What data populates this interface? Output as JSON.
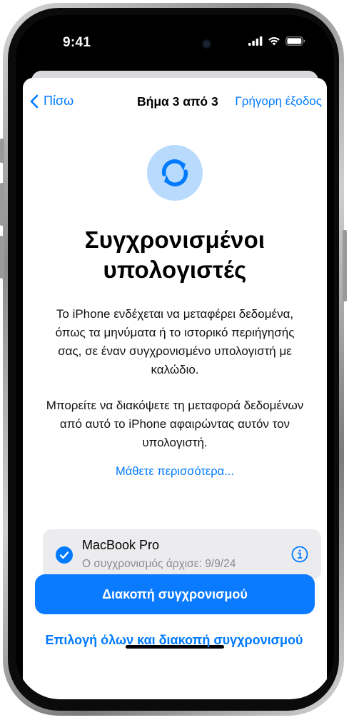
{
  "status_bar": {
    "time": "9:41",
    "icons": [
      "cellular-signal-icon",
      "wifi-icon",
      "battery-icon"
    ]
  },
  "nav": {
    "back_label": "Πίσω",
    "step_label": "Βήμα 3 από 3",
    "exit_label": "Γρήγορη έξοδος"
  },
  "content": {
    "icon": "sync-arrows-icon",
    "title": "Συγχρονισμένοι υπολογιστές",
    "paragraph_1": "Το iPhone ενδέχεται να μεταφέρει δεδομένα, όπως τα μηνύματα ή το ιστορικό περιήγησής σας, σε έναν συγχρονισμένο υπολογιστή με καλώδιο.",
    "paragraph_2": "Μπορείτε να διακόψετε τη μεταφορά δεδομένων από αυτό το iPhone αφαιρώντας αυτόν τον υπολογιστή.",
    "learn_more": "Μάθετε περισσότερα..."
  },
  "device": {
    "name": "MacBook Pro",
    "subtitle": "Ο συγχρονισμός άρχισε: 9/9/24",
    "selected": true
  },
  "actions": {
    "primary_label": "Διακοπή συγχρονισμού",
    "secondary_label": "Επιλογή όλων και διακοπή συγχρονισμού"
  },
  "colors": {
    "accent": "#007aff",
    "icon_circle": "#b8dafc",
    "card_background": "#ececef"
  }
}
